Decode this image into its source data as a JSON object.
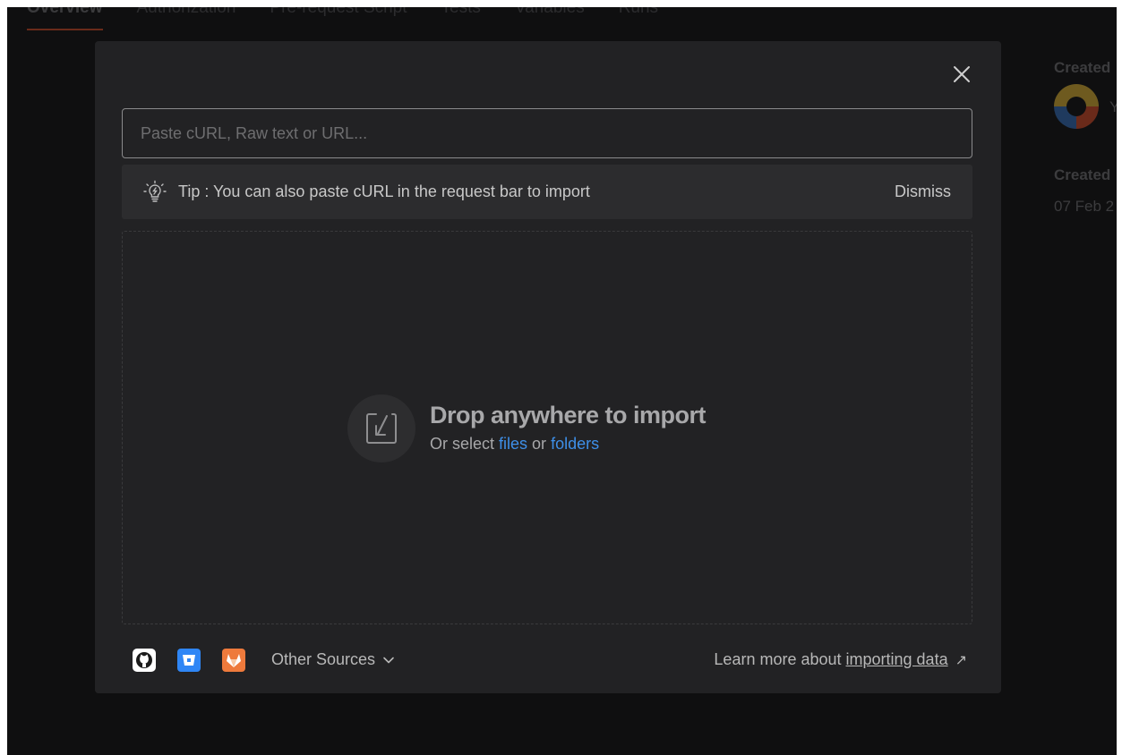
{
  "background": {
    "tabs": [
      {
        "label": "Overview",
        "active": true
      },
      {
        "label": "Authorization",
        "active": false
      },
      {
        "label": "Pre-request Script",
        "active": false
      },
      {
        "label": "Tests",
        "active": false
      },
      {
        "label": "Variables",
        "active": false
      },
      {
        "label": "Runs",
        "active": false
      }
    ],
    "side": {
      "created_by_label": "Created",
      "avatar_letter": "Y",
      "created_on_label": "Created",
      "created_on_value": "07 Feb 2"
    }
  },
  "modal": {
    "search": {
      "placeholder": "Paste cURL, Raw text or URL...",
      "value": ""
    },
    "tip": {
      "text": "Tip : You can also paste cURL in the request bar to import",
      "dismiss_label": "Dismiss"
    },
    "drop": {
      "title": "Drop anywhere to import",
      "prefix": "Or select ",
      "files_link": "files",
      "middle": " or ",
      "folders_link": "folders"
    },
    "footer": {
      "other_sources_label": "Other Sources",
      "learn_prefix": "Learn more about ",
      "learn_link": "importing data",
      "learn_suffix": "↗"
    }
  },
  "colors": {
    "accent_link": "#3e8fe8",
    "modal_bg": "#222224",
    "bitbucket": "#2f86f5",
    "gitlab": "#ee7a3c"
  }
}
